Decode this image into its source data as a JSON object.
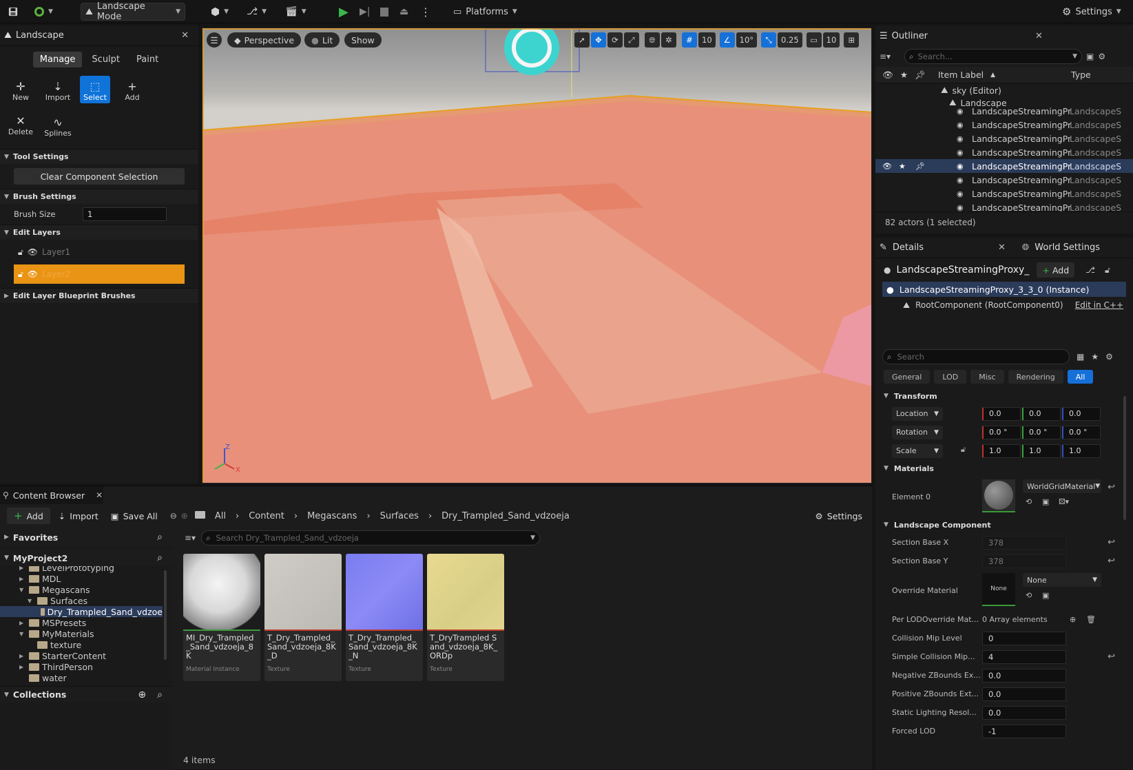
{
  "toolbar": {
    "mode_label": "Landscape Mode",
    "platforms_label": "Platforms",
    "settings_label": "Settings"
  },
  "landscape_panel": {
    "tab_title": "Landscape",
    "modes": [
      "Manage",
      "Sculpt",
      "Paint"
    ],
    "active_mode": "Manage",
    "tools": [
      {
        "label": "New",
        "icon": "new-icon"
      },
      {
        "label": "Import",
        "icon": "import-icon"
      },
      {
        "label": "Select",
        "icon": "select-icon"
      },
      {
        "label": "Add",
        "icon": "add-icon"
      },
      {
        "label": "Delete",
        "icon": "delete-icon"
      },
      {
        "label": "Splines",
        "icon": "splines-icon"
      }
    ],
    "active_tool": "Select",
    "tool_settings_header": "Tool Settings",
    "clear_selection_label": "Clear Component Selection",
    "brush_settings_header": "Brush Settings",
    "brush_size_label": "Brush Size",
    "brush_size_value": "1",
    "edit_layers_header": "Edit Layers",
    "layers": [
      "Layer1",
      "Layer2"
    ],
    "blueprint_brushes_header": "Edit Layer Blueprint Brushes"
  },
  "viewport": {
    "perspective_label": "Perspective",
    "lit_label": "Lit",
    "show_label": "Show",
    "grid_snap": "10",
    "rotation_snap": "10°",
    "scale_snap": "0.25",
    "camera_speed": "10",
    "axis_z": "Z",
    "axis_x": "X"
  },
  "outliner": {
    "tab_title": "Outliner",
    "search_placeholder": "Search...",
    "col_label": "Item Label",
    "col_type": "Type",
    "root_item": "sky (Editor)",
    "landscape_item": "Landscape",
    "rows": [
      {
        "label": "LandscapeStreamingPr",
        "type": "LandscapeS"
      },
      {
        "label": "LandscapeStreamingPr",
        "type": "LandscapeS"
      },
      {
        "label": "LandscapeStreamingPr",
        "type": "LandscapeS"
      },
      {
        "label": "LandscapeStreamingPr",
        "type": "LandscapeS"
      },
      {
        "label": "LandscapeStreamingPr",
        "type": "LandscapeS"
      },
      {
        "label": "LandscapeStreamingPr",
        "type": "LandscapeS"
      },
      {
        "label": "LandscapeStreamingPr",
        "type": "LandscapeS"
      },
      {
        "label": "LandscapeStreamingPr",
        "type": "LandscapeS"
      }
    ],
    "selected_row": 4,
    "status": "82 actors (1 selected)"
  },
  "details": {
    "tab_title": "Details",
    "world_settings_tab": "World Settings",
    "actor_name": "LandscapeStreamingProxy_",
    "add_label": "Add",
    "instance_label": "LandscapeStreamingProxy_3_3_0 (Instance)",
    "root_component": "RootComponent (RootComponent0)",
    "edit_cpp": "Edit in C++",
    "search_placeholder": "Search",
    "filter_tabs": [
      "General",
      "LOD",
      "Misc",
      "Rendering",
      "All"
    ],
    "active_filter": "All",
    "transform_header": "Transform",
    "location_label": "Location",
    "location": [
      "0.0",
      "0.0",
      "0.0"
    ],
    "rotation_label": "Rotation",
    "rotation": [
      "0.0 °",
      "0.0 °",
      "0.0 °"
    ],
    "scale_label": "Scale",
    "scale": [
      "1.0",
      "1.0",
      "1.0"
    ],
    "materials_header": "Materials",
    "element0_label": "Element 0",
    "element0_material": "WorldGridMaterial",
    "landscape_component_header": "Landscape Component",
    "section_base_x_label": "Section Base X",
    "section_base_x": "378",
    "section_base_y_label": "Section Base Y",
    "section_base_y": "378",
    "override_material_label": "Override Material",
    "override_material_thumb": "None",
    "override_material_value": "None",
    "per_lod_label": "Per LODOverride Mat...",
    "per_lod_value": "0 Array elements",
    "collision_mip_label": "Collision Mip Level",
    "collision_mip": "0",
    "simple_collision_label": "Simple Collision Mip...",
    "simple_collision": "4",
    "neg_z_label": "Negative ZBounds Ex...",
    "neg_z": "0.0",
    "pos_z_label": "Positive ZBounds Ext...",
    "pos_z": "0.0",
    "static_light_label": "Static Lighting Resol...",
    "static_light": "0.0",
    "forced_lod_label": "Forced LOD",
    "forced_lod": "-1"
  },
  "content_browser": {
    "tab_title": "Content Browser",
    "add_label": "Add",
    "import_label": "Import",
    "save_all_label": "Save All",
    "breadcrumbs": [
      "All",
      "Content",
      "Megascans",
      "Surfaces",
      "Dry_Trampled_Sand_vdzoeja"
    ],
    "settings_label": "Settings",
    "favorites_label": "Favorites",
    "project_label": "MyProject2",
    "search_placeholder": "Search Dry_Trampled_Sand_vdzoeja",
    "tree": [
      {
        "label": "LevelPrototyping",
        "depth": 1,
        "arrow": true
      },
      {
        "label": "MDL",
        "depth": 1,
        "arrow": true
      },
      {
        "label": "Megascans",
        "depth": 1,
        "arrow": true,
        "open": true
      },
      {
        "label": "Surfaces",
        "depth": 2,
        "arrow": true,
        "open": true
      },
      {
        "label": "Dry_Trampled_Sand_vdzoe",
        "depth": 3,
        "arrow": false,
        "selected": true
      },
      {
        "label": "MSPresets",
        "depth": 1,
        "arrow": true
      },
      {
        "label": "MyMaterials",
        "depth": 1,
        "arrow": true,
        "open": true
      },
      {
        "label": "texture",
        "depth": 2,
        "arrow": false
      },
      {
        "label": "StarterContent",
        "depth": 1,
        "arrow": true
      },
      {
        "label": "ThirdPerson",
        "depth": 1,
        "arrow": true
      },
      {
        "label": "water",
        "depth": 1,
        "arrow": false
      }
    ],
    "collections_label": "Collections",
    "assets": [
      {
        "name": "MI_Dry_Trampled_Sand_vdzoeja_8K",
        "type": "Material Instance",
        "color": "#3a9a3a"
      },
      {
        "name": "T_Dry_Trampled_Sand_vdzoeja_8K_D",
        "type": "Texture",
        "color": "#c0392b"
      },
      {
        "name": "T_Dry_Trampled_Sand_vdzoeja_8K_N",
        "type": "Texture",
        "color": "#c0392b"
      },
      {
        "name": "T_DryTrampled Sand_vdzoeja_8K_ORDp",
        "type": "Texture",
        "color": "#c0392b"
      }
    ],
    "item_count": "4 items"
  }
}
